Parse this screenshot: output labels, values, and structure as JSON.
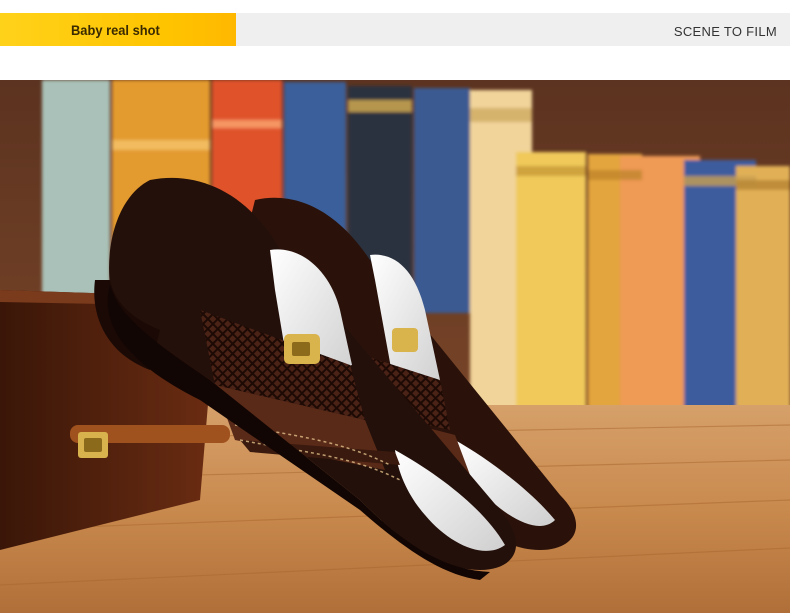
{
  "header": {
    "tab_label": "Baby real shot",
    "right_label": "SCENE TO FILM"
  },
  "photo": {
    "subject": "pair of brown patent leather slip-on dress shoes with gold buckle",
    "accent_colors": {
      "header_yellow": "#ffc400",
      "leather_dark": "#2a120a",
      "leather_brown": "#5a2a18",
      "wood_floor": "#c9874a"
    }
  }
}
